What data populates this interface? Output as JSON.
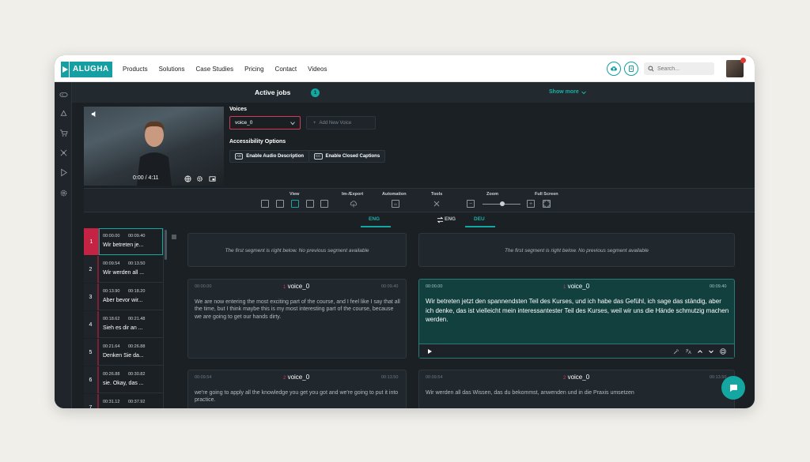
{
  "brand": {
    "name": "ALUGHA"
  },
  "nav": {
    "links": [
      "Products",
      "Solutions",
      "Case Studies",
      "Pricing",
      "Contact",
      "Videos"
    ],
    "search_placeholder": "Search..."
  },
  "jobs": {
    "title": "Active jobs",
    "count": "1",
    "show_more": "Show more"
  },
  "video": {
    "time": "0:00 / 4:11"
  },
  "voices": {
    "label": "Voices",
    "selected": "voice_0",
    "add_placeholder": "Add New Voice"
  },
  "accessibility": {
    "label": "Accessibility Options",
    "audio_desc_icon": "AD",
    "audio_desc": "Enable Audio Description",
    "captions_icon": "CC",
    "captions": "Enable Closed Captions"
  },
  "toolbar": {
    "view": "View",
    "im_export": "Im-/Export",
    "automation": "Automation",
    "tools": "Tools",
    "zoom": "Zoom",
    "fullscreen": "Full Screen"
  },
  "languages": {
    "source": "ENG",
    "target_alt": "ENG",
    "target": "DEU"
  },
  "segments": [
    {
      "n": "1",
      "start": "00:00.00",
      "end": "00:09.40",
      "text": "Wir betreten je..."
    },
    {
      "n": "2",
      "start": "00:09.54",
      "end": "00:13.50",
      "text": "Wir werden all ..."
    },
    {
      "n": "3",
      "start": "00:13.90",
      "end": "00:18.20",
      "text": "Aber bevor wir..."
    },
    {
      "n": "4",
      "start": "00:18.62",
      "end": "00:21.48",
      "text": "Sieh es dir an ..."
    },
    {
      "n": "5",
      "start": "00:21.64",
      "end": "00:26.88",
      "text": "Denken Sie da..."
    },
    {
      "n": "6",
      "start": "00:26.88",
      "end": "00:30.82",
      "text": "sie. Okay, das ..."
    },
    {
      "n": "7",
      "start": "00:31.12",
      "end": "00:37.92",
      "text": ""
    }
  ],
  "placeholder": "The first segment is right below. No previous segment available",
  "cards": {
    "src1": {
      "start": "00:00.00",
      "end": "00:09.40",
      "num": "1",
      "voice": "voice_0",
      "text": "We are now entering the most exciting part of the course, and I feel like I say that all the time, but I think maybe this is my most interesting part of the course, because we are going to get our hands dirty."
    },
    "tgt1": {
      "start": "00:00.00",
      "end": "00:09.40",
      "num": "1",
      "voice": "voice_0",
      "text": "Wir betreten jetzt den spannendsten Teil des Kurses, und ich habe das Gefühl, ich sage das ständig, aber ich denke, das ist vielleicht mein interessantester Teil des Kurses, weil wir uns die Hände schmutzig machen werden."
    },
    "src2": {
      "start": "00:09.54",
      "end": "00:13.50",
      "num": "2",
      "voice": "voice_0",
      "text": "we're going to apply all the knowledge you get you got and we're going to put it into practice."
    },
    "tgt2": {
      "start": "00:09.54",
      "end": "00:13.50",
      "num": "2",
      "voice": "voice_0",
      "text": "Wir werden all das Wissen, das du bekommst, anwenden und in die Praxis umsetzen"
    }
  },
  "colors": {
    "accent": "#14a6a0",
    "alert": "#c42344",
    "dark_bg": "#1b2025"
  }
}
